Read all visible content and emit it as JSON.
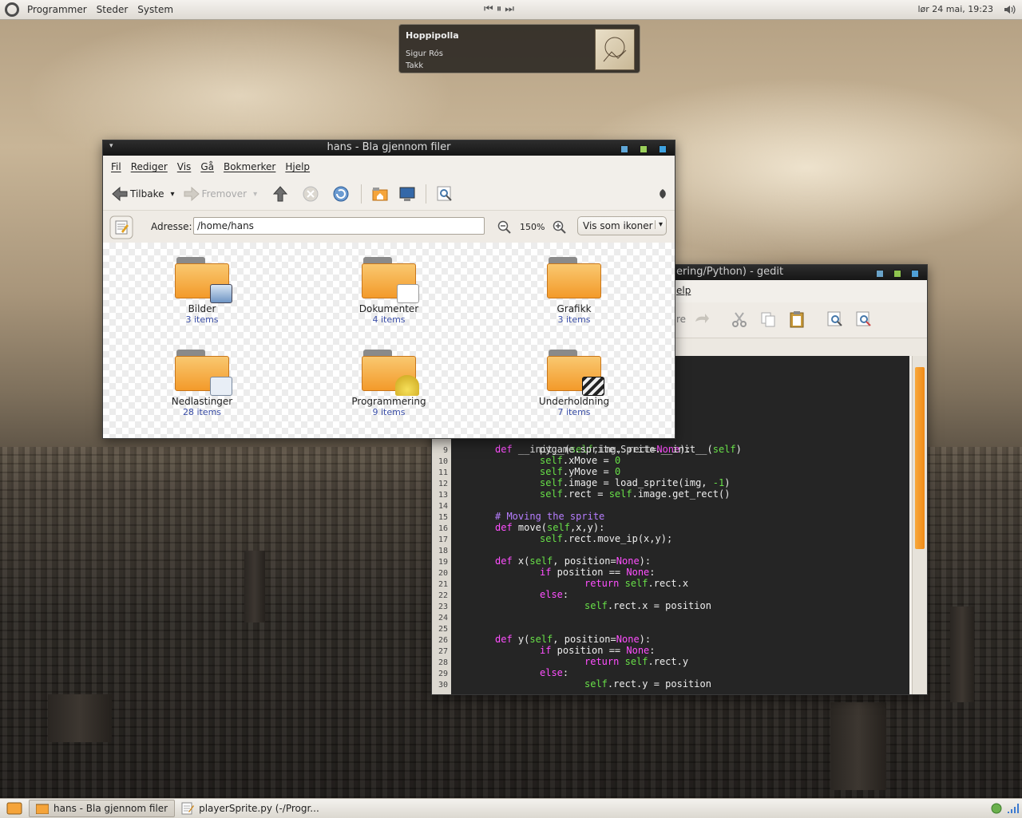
{
  "top_panel": {
    "menus": [
      "Programmer",
      "Steder",
      "System"
    ],
    "media_controls": [
      "⏮",
      "⏸",
      "⏭"
    ],
    "clock": "lør 24 mai, 19:23"
  },
  "notification": {
    "song": "Hoppipolla",
    "artist": "Sigur Rós",
    "album": "Takk"
  },
  "gedit": {
    "title": "ering/Python) - gedit",
    "menu_partial": "elp",
    "toolbar_partial": "re",
    "code_lines": [
      {
        "n": "9",
        "indent": 2,
        "tokens": [
          [
            "pygame.sprite.Sprite.__init__(",
            "n"
          ],
          [
            "self",
            "s"
          ],
          [
            ")",
            "n"
          ]
        ]
      },
      {
        "n": "10",
        "indent": 2,
        "tokens": [
          [
            "self",
            "s"
          ],
          [
            ".xMove = ",
            "n"
          ],
          [
            "0",
            "num"
          ]
        ]
      },
      {
        "n": "11",
        "indent": 2,
        "tokens": [
          [
            "self",
            "s"
          ],
          [
            ".yMove = ",
            "n"
          ],
          [
            "0",
            "num"
          ]
        ]
      },
      {
        "n": "12",
        "indent": 2,
        "tokens": [
          [
            "self",
            "s"
          ],
          [
            ".image = load_sprite(img, ",
            "n"
          ],
          [
            "-1",
            "num"
          ],
          [
            ")",
            "n"
          ]
        ]
      },
      {
        "n": "13",
        "indent": 2,
        "tokens": [
          [
            "self",
            "s"
          ],
          [
            ".rect = ",
            "n"
          ],
          [
            "self",
            "s"
          ],
          [
            ".image.get_rect()",
            "n"
          ]
        ]
      },
      {
        "n": "14",
        "indent": 0,
        "tokens": []
      },
      {
        "n": "15",
        "indent": 1,
        "tokens": [
          [
            "# Moving the sprite",
            "c"
          ]
        ]
      },
      {
        "n": "16",
        "indent": 1,
        "tokens": [
          [
            "def",
            "k"
          ],
          [
            " move(",
            "n"
          ],
          [
            "self",
            "s"
          ],
          [
            ",x,y):",
            "n"
          ]
        ]
      },
      {
        "n": "17",
        "indent": 2,
        "tokens": [
          [
            "self",
            "s"
          ],
          [
            ".rect.move_ip(x,y);",
            "n"
          ]
        ]
      },
      {
        "n": "18",
        "indent": 0,
        "tokens": []
      },
      {
        "n": "19",
        "indent": 1,
        "tokens": [
          [
            "def",
            "k"
          ],
          [
            " x(",
            "n"
          ],
          [
            "self",
            "s"
          ],
          [
            ", position=",
            "n"
          ],
          [
            "None",
            "k"
          ],
          [
            "):",
            "n"
          ]
        ]
      },
      {
        "n": "20",
        "indent": 2,
        "tokens": [
          [
            "if",
            "k"
          ],
          [
            " position == ",
            "n"
          ],
          [
            "None",
            "k"
          ],
          [
            ":",
            "n"
          ]
        ]
      },
      {
        "n": "21",
        "indent": 3,
        "tokens": [
          [
            "return",
            "k"
          ],
          [
            " ",
            "n"
          ],
          [
            "self",
            "s"
          ],
          [
            ".rect.x",
            "n"
          ]
        ]
      },
      {
        "n": "22",
        "indent": 2,
        "tokens": [
          [
            "else",
            "k"
          ],
          [
            ":",
            "n"
          ]
        ]
      },
      {
        "n": "23",
        "indent": 3,
        "tokens": [
          [
            "self",
            "s"
          ],
          [
            ".rect.x = position",
            "n"
          ]
        ]
      },
      {
        "n": "24",
        "indent": 0,
        "tokens": []
      },
      {
        "n": "25",
        "indent": 0,
        "tokens": []
      },
      {
        "n": "26",
        "indent": 1,
        "tokens": [
          [
            "def",
            "k"
          ],
          [
            " y(",
            "n"
          ],
          [
            "self",
            "s"
          ],
          [
            ", position=",
            "n"
          ],
          [
            "None",
            "k"
          ],
          [
            "):",
            "n"
          ]
        ]
      },
      {
        "n": "27",
        "indent": 2,
        "tokens": [
          [
            "if",
            "k"
          ],
          [
            " position == ",
            "n"
          ],
          [
            "None",
            "k"
          ],
          [
            ":",
            "n"
          ]
        ]
      },
      {
        "n": "28",
        "indent": 3,
        "tokens": [
          [
            "return",
            "k"
          ],
          [
            " ",
            "n"
          ],
          [
            "self",
            "s"
          ],
          [
            ".rect.y",
            "n"
          ]
        ]
      },
      {
        "n": "29",
        "indent": 2,
        "tokens": [
          [
            "else",
            "k"
          ],
          [
            ":",
            "n"
          ]
        ]
      },
      {
        "n": "30",
        "indent": 3,
        "tokens": [
          [
            "self",
            "s"
          ],
          [
            ".rect.y = position",
            "n"
          ]
        ]
      }
    ],
    "partial_line": "def __init__(self,img, rect=None):"
  },
  "nautilus": {
    "title": "hans - Bla gjennom filer",
    "menus": [
      "Fil",
      "Rediger",
      "Vis",
      "Gå",
      "Bokmerker",
      "Hjelp"
    ],
    "toolbar": {
      "back": "Tilbake",
      "forward": "Fremover"
    },
    "address_label": "Adresse:",
    "address_value": "/home/hans",
    "zoom": "150%",
    "view_mode": "Vis som ikoner",
    "folders": [
      {
        "name": "Bilder",
        "count": "3 items",
        "emblem": "image-emblem"
      },
      {
        "name": "Dokumenter",
        "count": "4 items",
        "emblem": "documents-emblem"
      },
      {
        "name": "Grafikk",
        "count": "3 items",
        "emblem": "graphics-emblem"
      },
      {
        "name": "Nedlastinger",
        "count": "28 items",
        "emblem": "downloads-emblem"
      },
      {
        "name": "Programmering",
        "count": "9 items",
        "emblem": "hardhat-emblem"
      },
      {
        "name": "Underholdning",
        "count": "7 items",
        "emblem": "clapperboard-emblem"
      }
    ]
  },
  "taskbar": {
    "items": [
      "hans - Bla gjennom filer",
      "playerSprite.py (-/Progr..."
    ]
  },
  "colors": {
    "folder_orange": "#f39a2a",
    "scroll_orange": "#f08b18",
    "keyword_pink": "#ff4fff",
    "self_green": "#68e048",
    "comment_purple": "#b77eff",
    "item_count_blue": "#3b4fa8"
  }
}
